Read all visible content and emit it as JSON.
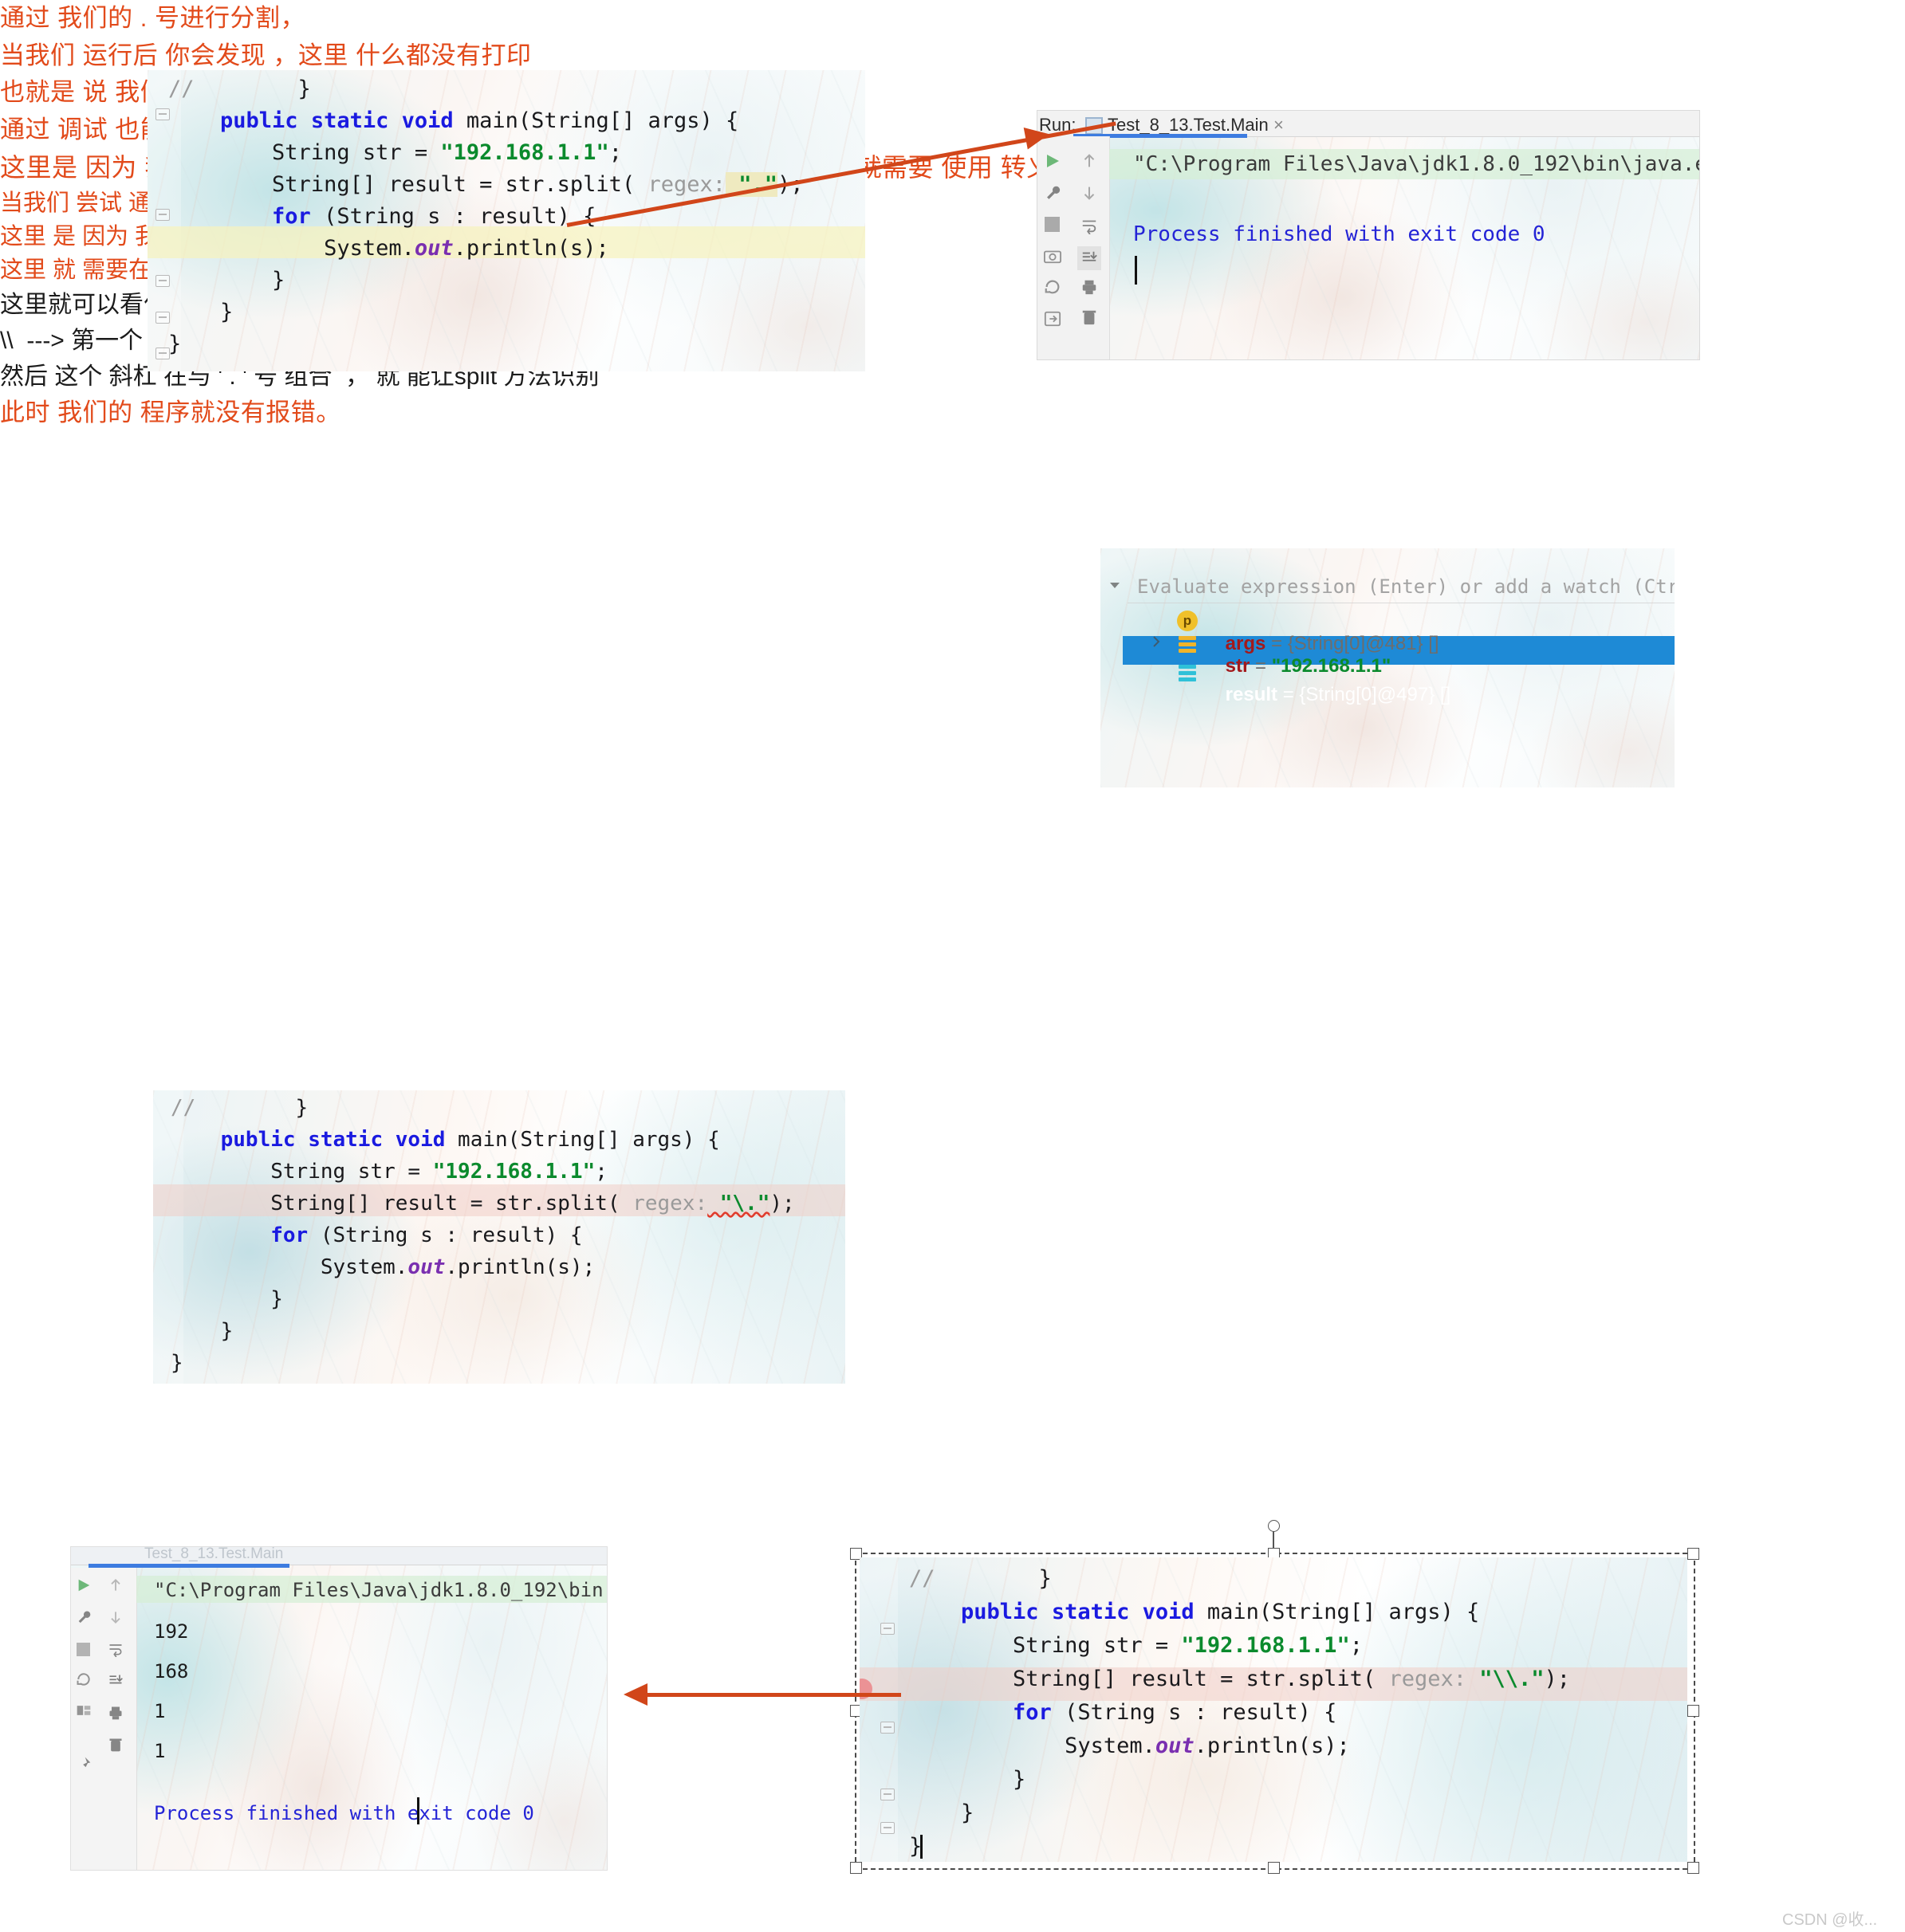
{
  "document": {
    "watermark": "CSDN @收..."
  },
  "section1": {
    "editor": {
      "lines": [
        {
          "indent": 0,
          "parts": [
            {
              "t": "//",
              "c": "hint"
            },
            {
              "t": "        }",
              "c": "plain"
            }
          ]
        },
        {
          "indent": 1,
          "parts": [
            {
              "t": "public static void ",
              "c": "kw"
            },
            {
              "t": "main(String[] args) {",
              "c": "plain"
            }
          ]
        },
        {
          "indent": 2,
          "parts": [
            {
              "t": "String str = ",
              "c": "plain"
            },
            {
              "t": "\"192.168.1.1\"",
              "c": "str"
            },
            {
              "t": ";",
              "c": "plain"
            }
          ]
        },
        {
          "indent": 2,
          "parts": [
            {
              "t": "String[] result = str.split( ",
              "c": "plain"
            },
            {
              "t": "regex:",
              "c": "hint"
            },
            {
              "t": " \".\"",
              "c": "str-hl"
            },
            {
              "t": ");",
              "c": "plain"
            }
          ]
        },
        {
          "indent": 2,
          "parts": [
            {
              "t": "for ",
              "c": "kw"
            },
            {
              "t": "(String s : result) {",
              "c": "plain"
            }
          ]
        },
        {
          "indent": 3,
          "parts": [
            {
              "t": "System.",
              "c": "plain"
            },
            {
              "t": "out",
              "c": "field"
            },
            {
              "t": ".println(s);",
              "c": "plain"
            }
          ]
        },
        {
          "indent": 2,
          "parts": [
            {
              "t": "}",
              "c": "plain"
            }
          ]
        },
        {
          "indent": 1,
          "parts": [
            {
              "t": "}",
              "c": "plain"
            }
          ]
        },
        {
          "indent": 0,
          "parts": [
            {
              "t": "}",
              "c": "plain"
            }
          ]
        }
      ],
      "highlight_line_index": 5,
      "highlight_color": "#f6f3be"
    },
    "console": {
      "run_label": "Run:",
      "tab_title": "Test_8_13.Test.Main",
      "tab_close": "×",
      "command_line": "\"C:\\Program Files\\Java\\jdk1.8.0_192\\bin\\java.exe",
      "exit_line": "Process finished with exit code 0",
      "toolbar_icons": [
        "run-icon",
        "wrench-icon",
        "stop-icon",
        "camera-icon",
        "rerun-icon",
        "export-icon"
      ],
      "toolbar_icons2": [
        "up-arrow-icon",
        "down-arrow-icon",
        "soft-wrap-icon",
        "scroll-end-icon",
        "print-icon",
        "trash-icon"
      ]
    },
    "caption_left": "通过 我们的 . 号进行分割，",
    "caption_right_line1": "当我们 运行后 你会发现 ，这里 什么都没有打印",
    "caption_right_line2": "也就是 说 我们的 字符并没 有完成分割。"
  },
  "section2": {
    "evaluate": {
      "placeholder": "Evaluate expression (Enter) or add a watch (Ctrl+Sh",
      "rows": [
        {
          "badge": "p",
          "name": "args",
          "eq": " = ",
          "value": "{String[0]@481} []",
          "selected": false,
          "expandable": false
        },
        {
          "badge": "list",
          "name": "str",
          "eq": " = ",
          "value": "\"192.168.1.1\"",
          "selected": false,
          "expandable": true
        },
        {
          "badge": "list",
          "name": "result",
          "eq": " = ",
          "value": "{String[0]@497} []",
          "selected": true,
          "expandable": false
        }
      ],
      "selection_color": "#1e8ad6"
    },
    "caption": "通过 调试 也能看到我们的 result 中并没有 东西"
  },
  "section3": {
    "headline": "这里是 因为 我们的   .  符号 具有 特殊性， 如果 想要让 split 识别 处 . 号，就需要 使用 转义 字符 ' \\ '，进行转义。",
    "editor": {
      "lines": [
        {
          "indent": 0,
          "parts": [
            {
              "t": "//",
              "c": "hint"
            },
            {
              "t": "        }",
              "c": "plain"
            }
          ]
        },
        {
          "indent": 1,
          "parts": [
            {
              "t": "public static void ",
              "c": "kw"
            },
            {
              "t": "main(String[] args) {",
              "c": "plain"
            }
          ]
        },
        {
          "indent": 2,
          "parts": [
            {
              "t": "String str = ",
              "c": "plain"
            },
            {
              "t": "\"192.168.1.1\"",
              "c": "str"
            },
            {
              "t": ";",
              "c": "plain"
            }
          ]
        },
        {
          "indent": 2,
          "parts": [
            {
              "t": "String[] result = str.split( ",
              "c": "plain"
            },
            {
              "t": "regex:",
              "c": "hint"
            },
            {
              "t": " \"\\.\"",
              "c": "str-sq"
            },
            {
              "t": ");",
              "c": "plain"
            }
          ]
        },
        {
          "indent": 2,
          "parts": [
            {
              "t": "for ",
              "c": "kw"
            },
            {
              "t": "(String s : result) {",
              "c": "plain"
            }
          ]
        },
        {
          "indent": 3,
          "parts": [
            {
              "t": "System.",
              "c": "plain"
            },
            {
              "t": "out",
              "c": "field"
            },
            {
              "t": ".println(s);",
              "c": "plain"
            }
          ]
        },
        {
          "indent": 2,
          "parts": [
            {
              "t": "}",
              "c": "plain"
            }
          ]
        },
        {
          "indent": 1,
          "parts": [
            {
              "t": "}",
              "c": "plain"
            }
          ]
        },
        {
          "indent": 0,
          "parts": [
            {
              "t": "}",
              "c": "plain"
            }
          ]
        }
      ],
      "error_line_index": 3,
      "error_color": "#f0cdc6"
    },
    "notes_red": [
      "当我们 尝试 通过 ' \\ ' 进行 转义  会发向 报错 了，",
      "这里 是 因为 我们 的 ' \\ ' 也 是一个 特殊 的 转义 字符，同样是 需要转义 的，",
      "这里 就 需要在加上 一个 ' \\ '"
    ],
    "note_black_1": "这里就可以看作 两个 \\ 等于 一个 \\",
    "notes_black_2": [
      "\\\\  ---> 第一个 \\ 将 第二个 \\ 转义 为  一个 普通的 \\ ，",
      "然后 这个 斜杠 在与 ' . ' 号 组合  ， 就 能让split 方法识别"
    ],
    "caption_bottom": "此时 我们的 程序就没有报错。"
  },
  "section4": {
    "console": {
      "tab_title_faint": "Test_8_13.Test.Main",
      "command_line": "\"C:\\Program Files\\Java\\jdk1.8.0_192\\bin",
      "output_lines": [
        "192",
        "168",
        "1",
        "1"
      ],
      "exit_line": "Process finished with exit code 0",
      "toolbar_icons": [
        "run-icon",
        "wrench-icon",
        "stop-icon",
        "rerun-icon",
        "layout-icon",
        "pin-icon"
      ],
      "toolbar_icons2": [
        "up-arrow-icon",
        "down-arrow-icon",
        "soft-wrap-icon",
        "scroll-end-icon",
        "print-icon",
        "trash-icon"
      ]
    },
    "editor": {
      "lines": [
        {
          "indent": 0,
          "parts": [
            {
              "t": "//",
              "c": "hint"
            },
            {
              "t": "        }",
              "c": "plain"
            }
          ]
        },
        {
          "indent": 1,
          "parts": [
            {
              "t": "public static void ",
              "c": "kw"
            },
            {
              "t": "main(String[] args) {",
              "c": "plain"
            }
          ]
        },
        {
          "indent": 2,
          "parts": [
            {
              "t": "String str = ",
              "c": "plain"
            },
            {
              "t": "\"192.168.1.1\"",
              "c": "str"
            },
            {
              "t": ";",
              "c": "plain"
            }
          ]
        },
        {
          "indent": 2,
          "parts": [
            {
              "t": "String[] result = str.split( ",
              "c": "plain"
            },
            {
              "t": "regex:",
              "c": "hint"
            },
            {
              "t": " \"\\\\.\"",
              "c": "str"
            },
            {
              "t": ");",
              "c": "plain"
            }
          ]
        },
        {
          "indent": 2,
          "parts": [
            {
              "t": "for ",
              "c": "kw"
            },
            {
              "t": "(String s : result) {",
              "c": "plain"
            }
          ]
        },
        {
          "indent": 3,
          "parts": [
            {
              "t": "System.",
              "c": "plain"
            },
            {
              "t": "out",
              "c": "field"
            },
            {
              "t": ".println(s);",
              "c": "plain"
            }
          ]
        },
        {
          "indent": 2,
          "parts": [
            {
              "t": "}",
              "c": "plain"
            }
          ]
        },
        {
          "indent": 1,
          "parts": [
            {
              "t": "}",
              "c": "plain"
            }
          ]
        },
        {
          "indent": 0,
          "parts": [
            {
              "t": "}",
              "c": "plain"
            }
          ]
        }
      ],
      "highlight_line_index": 3,
      "highlight_color": "#f0cdc6",
      "selected": true
    }
  },
  "colors": {
    "annotation_red": "#e24a1a",
    "arrow": "#d1461a",
    "keyword_blue": "#1a1ae0",
    "string_green": "#0b8a2d",
    "console_blue": "#2424d6",
    "selection_blue": "#1e8ad6"
  }
}
